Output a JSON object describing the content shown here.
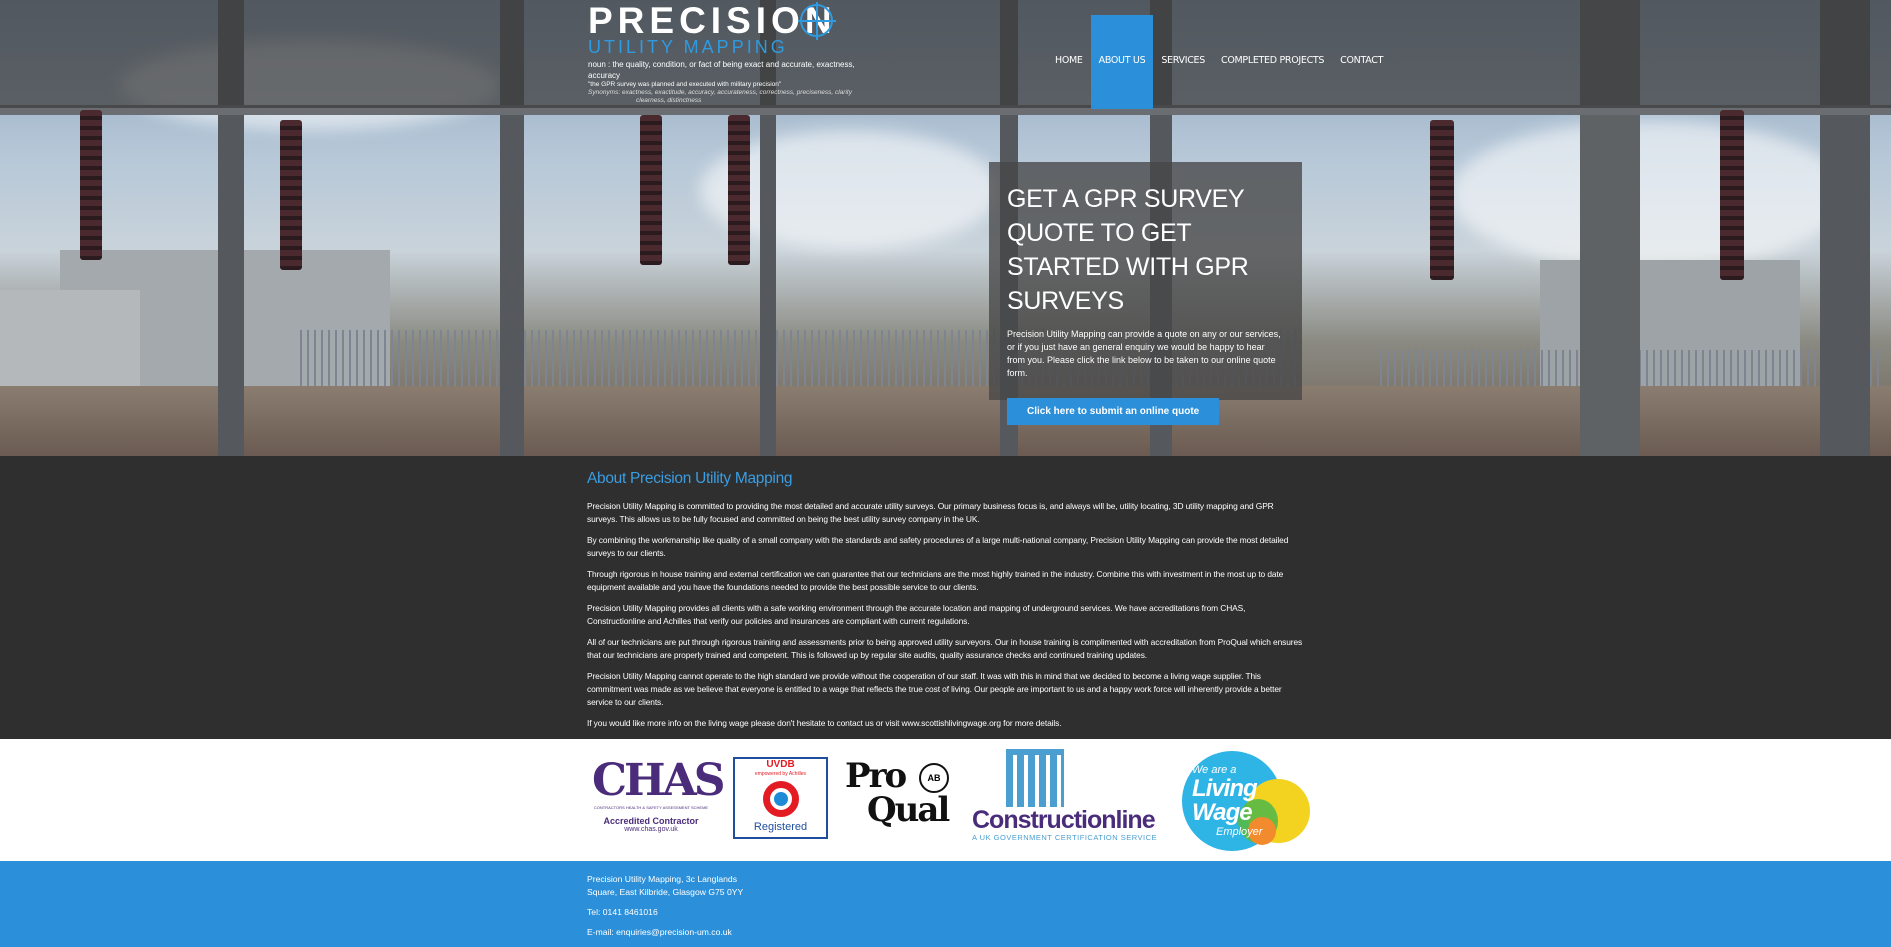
{
  "header": {
    "brand": "PRECISION",
    "brand_sub": "UTILITY MAPPING",
    "definition": "noun : the quality, condition, or fact of being exact and accurate, exactness, accuracy",
    "example": "\"the GPR survey was planned and executed with military precision\"",
    "synonyms": "Synonyms:         exactness, exactitude, accuracy, accurateness, correctness, preciseness, clarity",
    "synonyms2": "clearness, distinctness"
  },
  "nav": {
    "items": [
      {
        "label": "HOME"
      },
      {
        "label": "ABOUT US"
      },
      {
        "label": "SERVICES"
      },
      {
        "label": "COMPLETED PROJECTS"
      },
      {
        "label": "CONTACT"
      }
    ],
    "active": "ABOUT US"
  },
  "quote": {
    "title": "GET A GPR SURVEY QUOTE TO GET STARTED WITH GPR SURVEYS",
    "text": "Precision Utility Mapping can provide a quote on any or our services, or if you just have an general enquiry we would be happy to hear from you. Please click the link below to be taken to our online quote form.",
    "button": "Click here to submit an online quote"
  },
  "about": {
    "title": "About Precision Utility Mapping",
    "paragraphs": [
      "Precision Utility Mapping is committed to providing the most detailed and accurate utility surveys. Our primary business focus is, and always will be, utility locating, 3D utility mapping and GPR surveys. This allows us to be fully focused and committed on being the best utility survey company in the UK.",
      "By combining the workmanship like quality of a small company with the standards and safety procedures of a large multi-national company, Precision Utility Mapping can provide the most detailed surveys to our clients.",
      "Through rigorous in house training and external certification we can guarantee that our technicians are the most highly trained in the industry.  Combine this with investment in the most up to date equipment available and you have the foundations needed to provide the best possible service to our clients.",
      "Precision Utility Mapping provides all clients with a safe working environment through the accurate location and mapping of underground services. We have accreditations from CHAS, Constructionline and Achilles that verify our policies and insurances are compliant with current regulations.",
      "All of our technicians are put through rigorous training and assessments prior to being approved utility surveyors. Our in house training is complimented with accreditation from ProQual which ensures that our technicians are properly trained and competent. This is followed up by regular site audits, quality assurance checks and continued training updates.",
      "Precision Utility Mapping cannot operate to the high standard we provide without the cooperation of our staff. It was with this in mind that we decided to become a living wage supplier. This commitment was made as we believe that everyone is entitled to a wage that reflects the true cost of living. Our people are important to us and a happy work force will inherently provide a better service to our clients.",
      "If you would like more info on the living wage please don't hesitate to contact us or visit www.scottishlivingwage.org for more details."
    ]
  },
  "logos": {
    "chas": {
      "name": "CHAS",
      "small": "CONTRACTORS HEALTH & SAFETY ASSESSMENT SCHEME",
      "accredited": "Accredited Contractor",
      "url": "www.chas.gov.uk"
    },
    "uvdb": {
      "name": "UVDB",
      "powered": "empowered by Achilles",
      "status": "Registered"
    },
    "proqual": {
      "line1": "Pro",
      "line2": "Qual",
      "badge": "AB"
    },
    "constructionline": {
      "name": "Constructionline",
      "tag": "A UK GOVERNMENT CERTIFICATION SERVICE"
    },
    "livingwage": {
      "line1": "We are a",
      "line2": "Living",
      "line3": "Wage",
      "line4": "Employer"
    }
  },
  "footer": {
    "address1": "Precision Utility Mapping, 3c Langlands",
    "address2": "Square, East Kilbride, Glasgow G75 0YY",
    "tel": "Tel: 0141 8461016",
    "email": "E-mail: enquiries@precision-um.co.uk"
  },
  "colors": {
    "accent": "#2b90d9",
    "dark": "#2f2f2f",
    "purple": "#4a2c7a"
  }
}
